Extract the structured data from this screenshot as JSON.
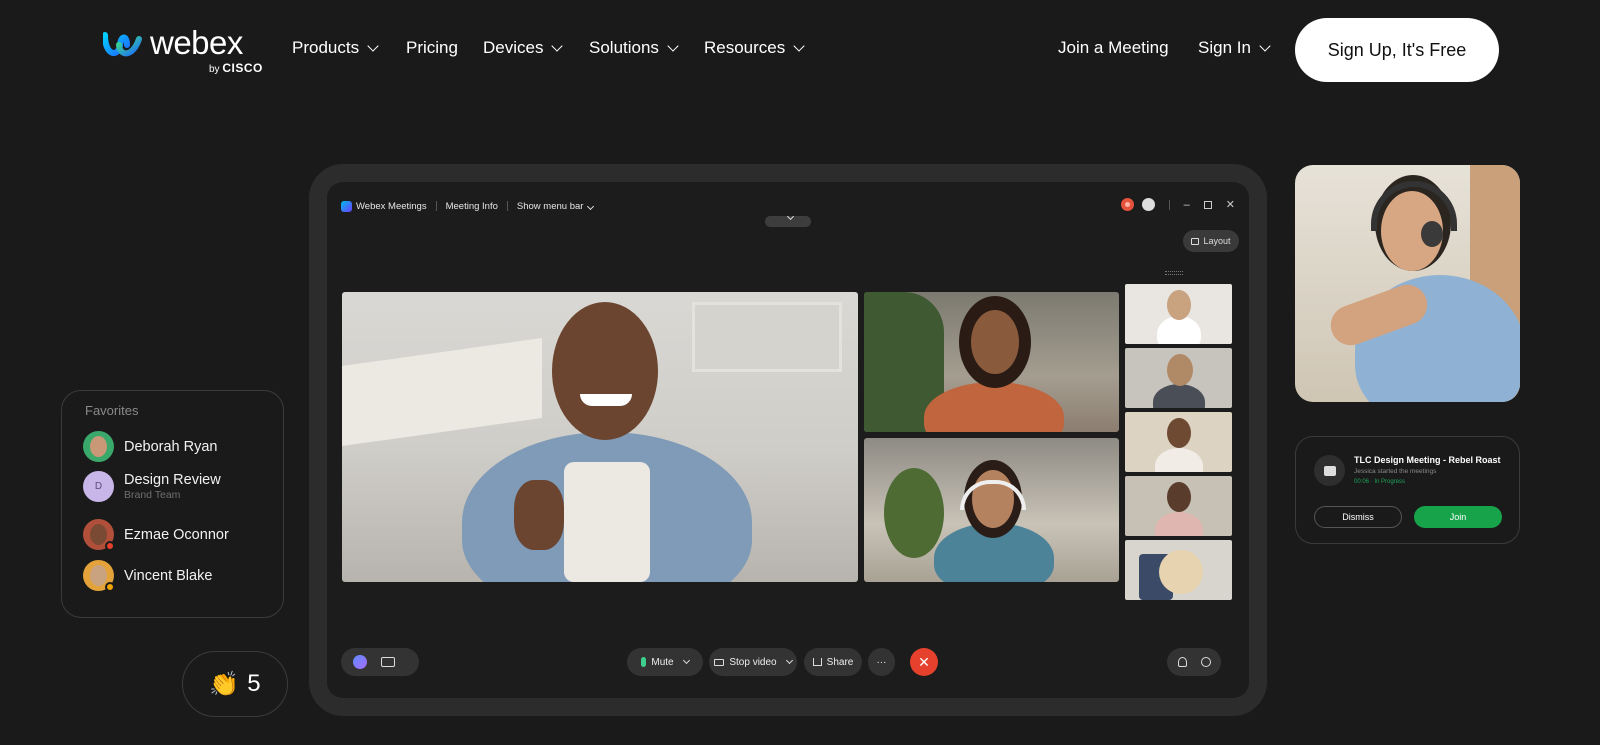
{
  "brand": {
    "name": "webex",
    "by": "by",
    "parent": "CISCO"
  },
  "nav": {
    "items": [
      {
        "label": "Products",
        "dropdown": true
      },
      {
        "label": "Pricing",
        "dropdown": false
      },
      {
        "label": "Devices",
        "dropdown": true
      },
      {
        "label": "Solutions",
        "dropdown": true
      },
      {
        "label": "Resources",
        "dropdown": true
      }
    ],
    "join_meeting": "Join a Meeting",
    "sign_in": "Sign In",
    "signup": "Sign Up, It's Free"
  },
  "meeting_window": {
    "app_name": "Webex Meetings",
    "meeting_info": "Meeting Info",
    "show_menu_bar": "Show menu bar",
    "layout": "Layout",
    "controls": {
      "mute": "Mute",
      "stop_video": "Stop video",
      "share": "Share",
      "more": "···",
      "end": "✕"
    }
  },
  "favorites": {
    "title": "Favorites",
    "items": [
      {
        "name": "Deborah Ryan",
        "subtitle": "",
        "avatar_color": "#3aa86b"
      },
      {
        "name": "Design Review",
        "subtitle": "Brand Team",
        "initial": "D",
        "avatar_color": "#c9b6e8"
      },
      {
        "name": "Ezmae Oconnor",
        "subtitle": "",
        "avatar_color": "#b0503a"
      },
      {
        "name": "Vincent Blake",
        "subtitle": "",
        "avatar_color": "#e3a33a"
      }
    ]
  },
  "reactions": {
    "emoji": "👏",
    "count": "5"
  },
  "notification": {
    "title": "TLC Design Meeting - Rebel Roast",
    "subtitle": "Jessica started the meetings",
    "time": "00:06",
    "status": "In Progress",
    "dismiss": "Dismiss",
    "join": "Join"
  },
  "colors": {
    "background": "#1a1a1a",
    "accent_green": "#16a34a",
    "end_call": "#e5412c"
  }
}
